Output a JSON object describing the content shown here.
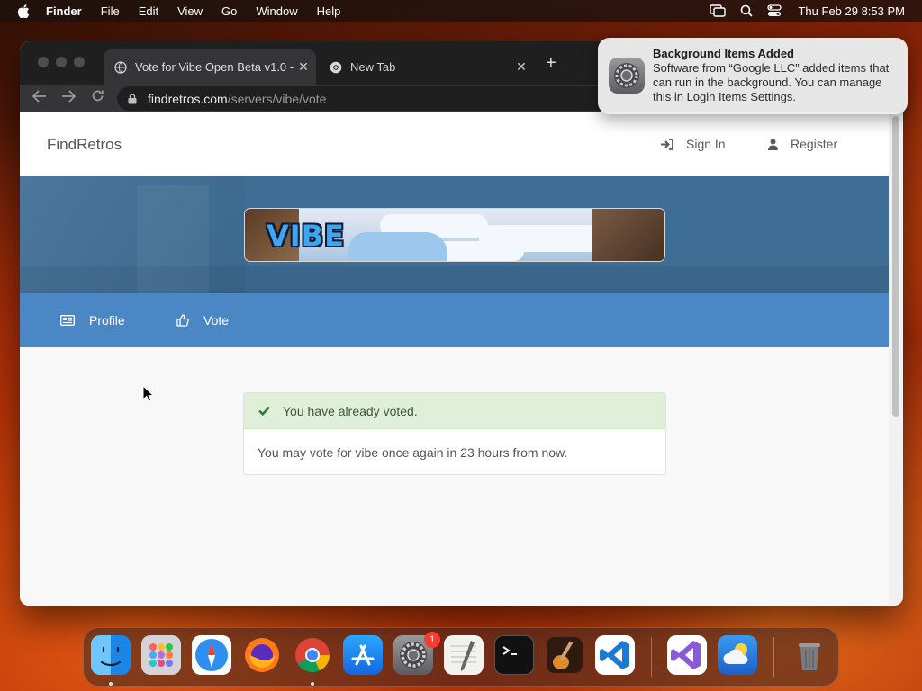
{
  "menubar": {
    "app_name": "Finder",
    "items": [
      "File",
      "Edit",
      "View",
      "Go",
      "Window",
      "Help"
    ],
    "clock": "Thu Feb 29  8:53 PM"
  },
  "browser": {
    "tabs": [
      {
        "title": "Vote for Vibe Open Beta v1.0 -",
        "active": true
      },
      {
        "title": "New Tab",
        "active": false
      }
    ],
    "new_tab_label": "+",
    "close_label": "✕",
    "url": {
      "host": "findretros.com",
      "path": "/servers/vibe/vote"
    }
  },
  "page": {
    "brand": "FindRetros",
    "header_links": {
      "sign_in": "Sign In",
      "register": "Register"
    },
    "banner_text": "VIBE",
    "subnav": {
      "profile": "Profile",
      "vote": "Vote"
    },
    "alert": {
      "title": "You have already voted.",
      "body": "You may vote for vibe once again in 23 hours from now."
    }
  },
  "notification": {
    "title": "Background Items Added",
    "body": "Software from “Google LLC” added items that can run in the background. You can manage this in Login Items Settings."
  },
  "dock": {
    "apps": [
      {
        "name": "Finder",
        "icon": "finder-icon",
        "color": "#2a8cf0",
        "running": true
      },
      {
        "name": "Launchpad",
        "icon": "launchpad-icon",
        "color": "#c9c9cc",
        "running": false
      },
      {
        "name": "Safari",
        "icon": "safari-icon",
        "color": "#2d8ff0",
        "running": false
      },
      {
        "name": "Firefox",
        "icon": "firefox-icon",
        "color": "#ff7a1a",
        "running": false
      },
      {
        "name": "Chrome",
        "icon": "chrome-icon",
        "color": "#ffffff",
        "running": true
      },
      {
        "name": "App Store",
        "icon": "app-store-icon",
        "color": "#1c8df5",
        "running": false
      },
      {
        "name": "System Settings",
        "icon": "system-settings-icon",
        "color": "#8e8e92",
        "running": false,
        "badge": "1"
      },
      {
        "name": "TextEdit",
        "icon": "textedit-icon",
        "color": "#f2f2ee",
        "running": false
      },
      {
        "name": "Terminal",
        "icon": "terminal-icon",
        "color": "#111111",
        "running": false
      },
      {
        "name": "GarageBand",
        "icon": "garageband-icon",
        "color": "#6b3a18",
        "running": false
      },
      {
        "name": "Visual Studio Code",
        "icon": "vscode-icon",
        "color": "#ffffff",
        "running": false
      },
      {
        "name": "Visual Studio",
        "icon": "visual-studio-icon",
        "color": "#ffffff",
        "running": false
      },
      {
        "name": "Weather",
        "icon": "weather-icon",
        "color": "#2d7fe0",
        "running": false
      },
      {
        "name": "Trash",
        "icon": "trash-icon",
        "color": "#8a8a8e",
        "running": false
      }
    ]
  },
  "colors": {
    "subnav": "#4a87c4",
    "hero": "#3e6d95",
    "alert_bg": "#e0f0d8",
    "alert_check": "#3c763d"
  }
}
